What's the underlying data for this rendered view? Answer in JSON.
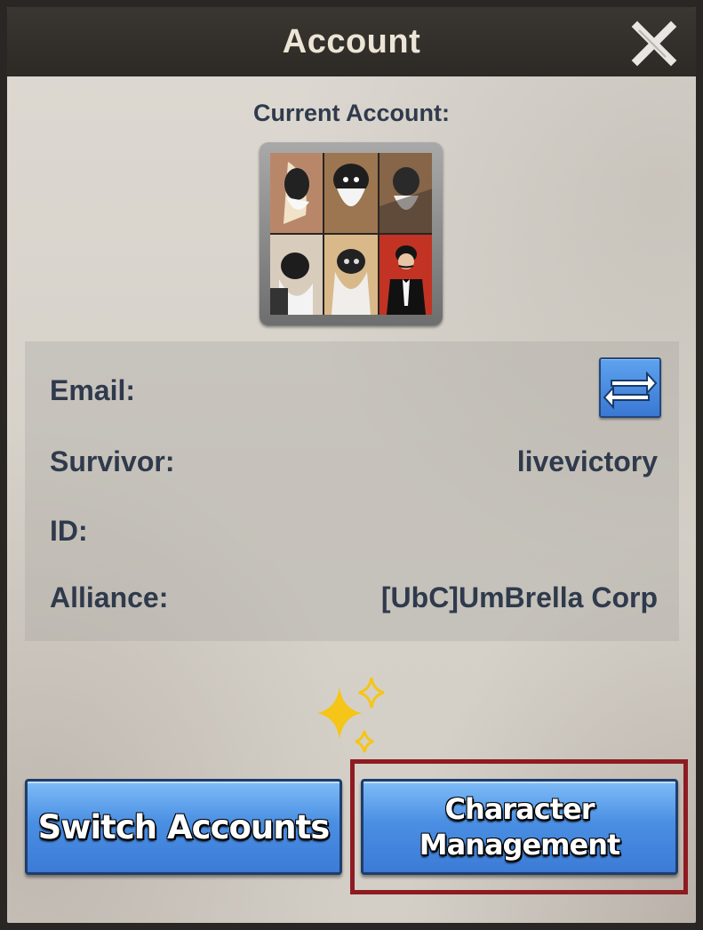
{
  "dialog": {
    "title": "Account",
    "close_icon": "close-x-icon"
  },
  "account": {
    "current_label": "Current Account:",
    "avatar_icon": "player-avatar"
  },
  "info": {
    "email_label": "Email:",
    "email_value": "",
    "swap_icon": "swap-arrows-icon",
    "survivor_label": "Survivor:",
    "survivor_value": "livevictory",
    "id_label": "ID:",
    "id_value": "",
    "alliance_label": "Alliance:",
    "alliance_value": "[UbC]UmBrella Corp"
  },
  "buttons": {
    "switch_accounts": "Switch Accounts",
    "character_management_line1": "Character",
    "character_management_line2": "Management"
  },
  "colors": {
    "button_blue": "#4a8fe3",
    "label_text": "#2f3a4c",
    "highlight_border": "#8e1b22",
    "sparkle": "#f5c518"
  }
}
